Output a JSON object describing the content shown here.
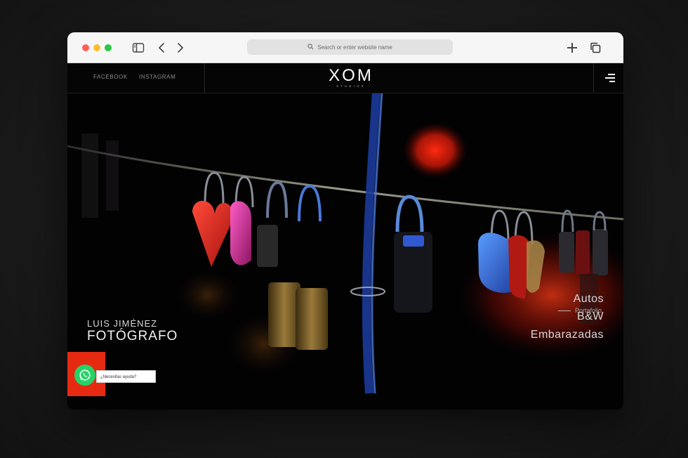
{
  "browser": {
    "address_placeholder": "Search or enter website name",
    "icons": {
      "sidebar": "sidebar-icon",
      "back": "chevron-left-icon",
      "forward": "chevron-right-icon",
      "search": "search-icon",
      "new_tab": "plus-icon",
      "tabs": "tabs-overview-icon"
    }
  },
  "site": {
    "nav": {
      "social_links": [
        "FACEBOOK",
        "INSTAGRAM"
      ],
      "logo_text": "XOM",
      "logo_sub": "STUDIOS",
      "menu_icon": "hamburger-menu-icon"
    },
    "hero": {
      "photographer_name": "LUIS JIMÉNEZ",
      "photographer_role": "FOTÓGRAFO",
      "portfolio_label": "Portafolio",
      "categories": [
        "Autos",
        "B&W",
        "Embarazadas"
      ]
    },
    "help_widget": {
      "icon": "whatsapp-icon",
      "text": "¿Necesitas ayuda?",
      "accent_color": "#e62a12",
      "whatsapp_color": "#25d366"
    }
  }
}
